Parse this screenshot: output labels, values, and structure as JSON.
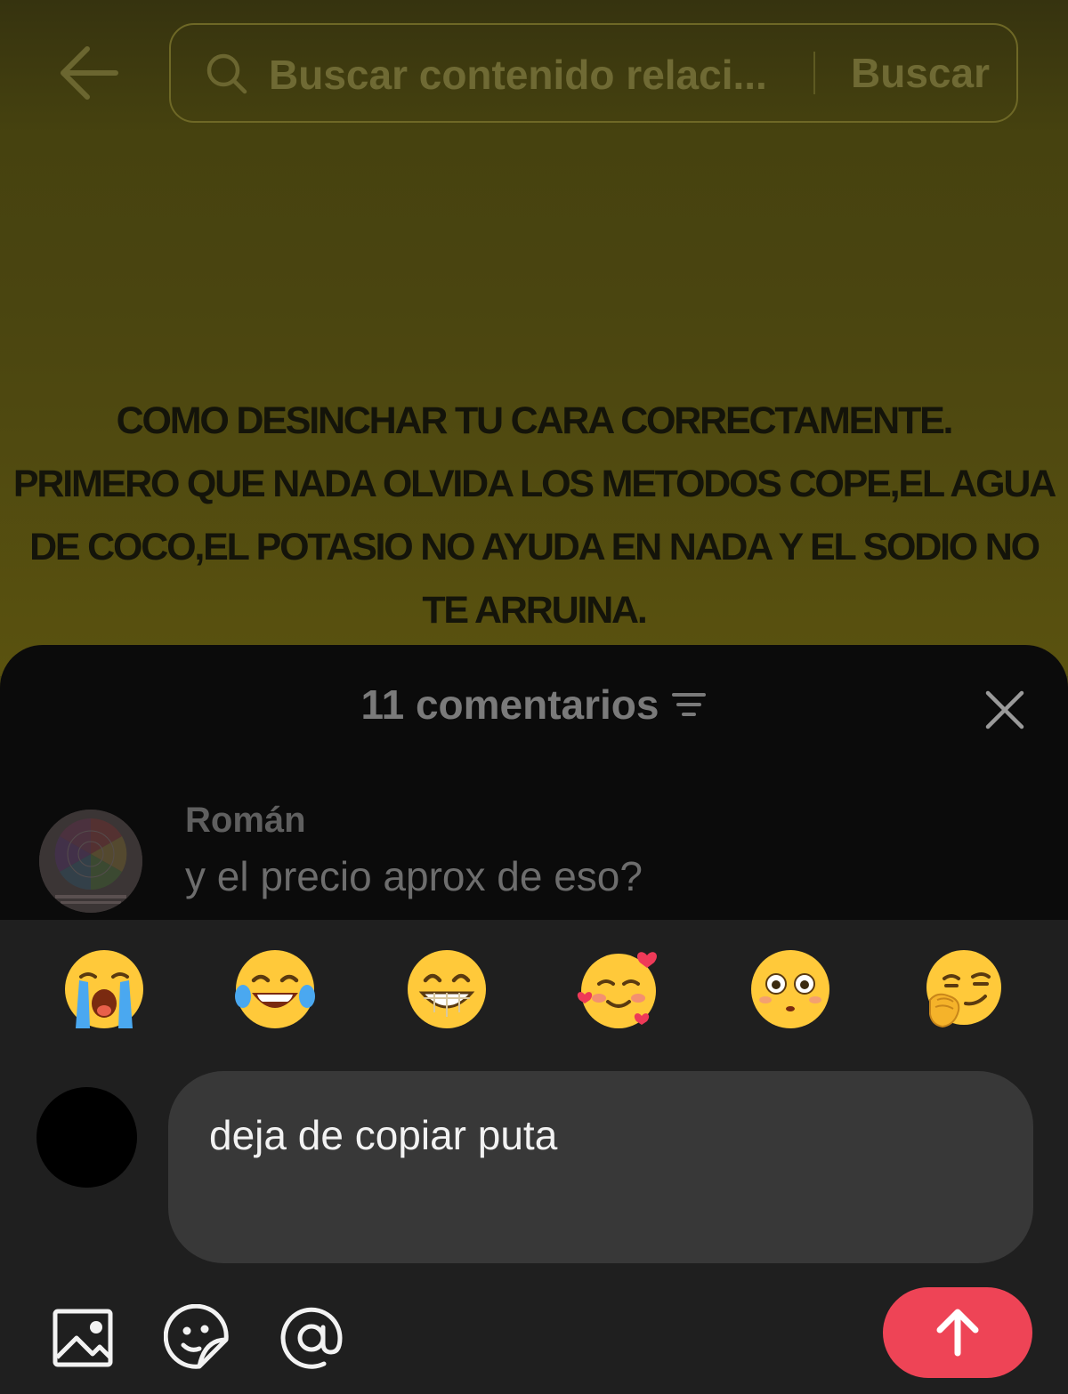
{
  "search": {
    "placeholder": "Buscar contenido relaci...",
    "button_label": "Buscar"
  },
  "video": {
    "overlay_lines": [
      "COMO DESINCHAR TU CARA CORRECTAMENTE.",
      "PRIMERO QUE NADA OLVIDA LOS METODOS COPE,EL AGUA",
      "DE COCO,EL POTASIO NO AYUDA EN NADA Y EL SODIO NO",
      "TE ARRUINA."
    ]
  },
  "comments_sheet": {
    "count_label": "11 comentarios",
    "comments": [
      {
        "username": "Román",
        "text": "y el precio aprox de eso?"
      }
    ]
  },
  "composer": {
    "quick_emojis": [
      "loudly-crying-face",
      "face-with-tears-of-joy",
      "beaming-face",
      "smiling-face-with-hearts",
      "flushed-face",
      "smirking-hand-over-mouth-face"
    ],
    "input_value": "deja de copiar puta",
    "tools": [
      "image-icon",
      "sticker-icon",
      "mention-icon"
    ],
    "send_color": "#ee4456"
  }
}
